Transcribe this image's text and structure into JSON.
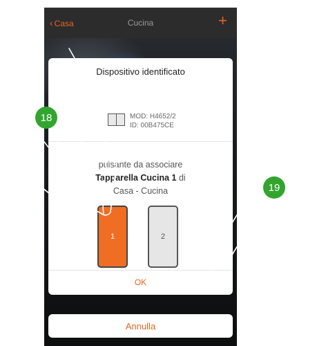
{
  "header": {
    "back_label": "Casa",
    "title": "Cucina",
    "add_symbol": "+"
  },
  "dialog": {
    "title": "Dispositivo identificato",
    "device_icon": "double-switch-icon",
    "model": "MOD: H4652/2",
    "id": "ID: 00B475CE",
    "instruction_prefix": "pulsante da associare",
    "instruction_target": "Tapparella Cucina 1",
    "instruction_di": "di",
    "instruction_location": "Casa - Cucina",
    "buttons": [
      {
        "label": "1",
        "selected": true
      },
      {
        "label": "2",
        "selected": false
      }
    ],
    "ok_label": "OK"
  },
  "cancel_label": "Annulla",
  "steps": {
    "step1": "18",
    "step2": "19"
  },
  "colors": {
    "accent": "#e8641f",
    "selected_key": "#ef6e23",
    "badge": "#32a52f"
  }
}
